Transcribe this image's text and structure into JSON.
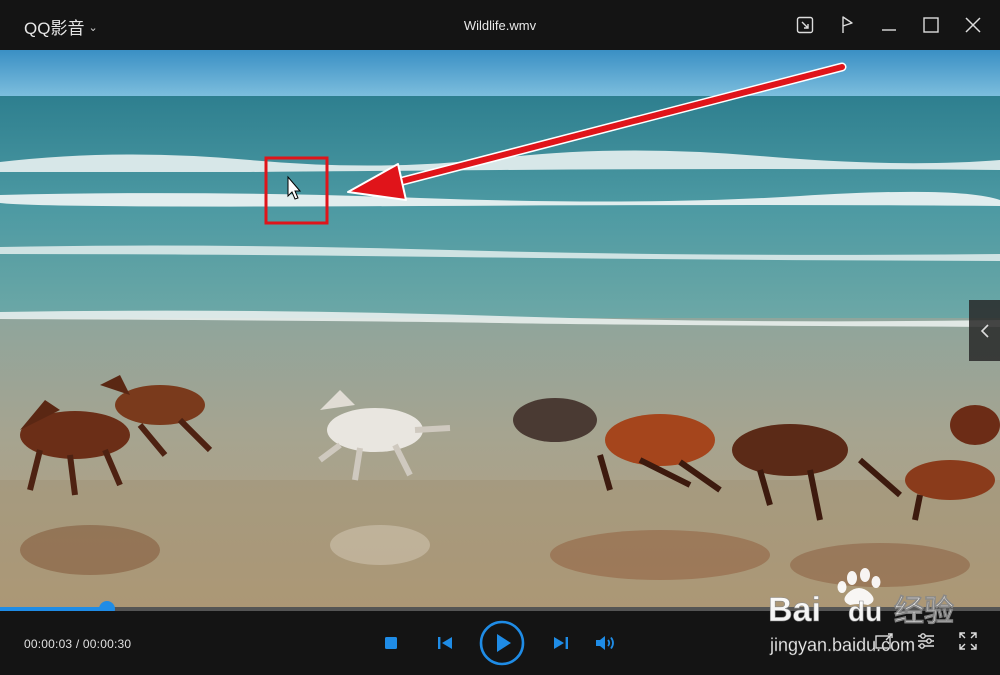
{
  "app": {
    "brand_label": "QQ影音",
    "window_title": "Wildlife.wmv"
  },
  "window_buttons": [
    {
      "name": "mini-mode-icon"
    },
    {
      "name": "pin-icon"
    },
    {
      "name": "minimize-icon"
    },
    {
      "name": "maximize-icon"
    },
    {
      "name": "close-icon"
    }
  ],
  "playback": {
    "current_time": "00:00:03",
    "separator": " / ",
    "total_time": "00:00:30",
    "progress_fraction": 0.107
  },
  "watermark": {
    "brand": "Bai",
    "brand_tail": "du",
    "cn": "经验",
    "url": "jingyan.baidu.com"
  },
  "colors": {
    "accent": "#1f8ce6",
    "annotation": "#e0141a",
    "chrome": "#141414"
  }
}
